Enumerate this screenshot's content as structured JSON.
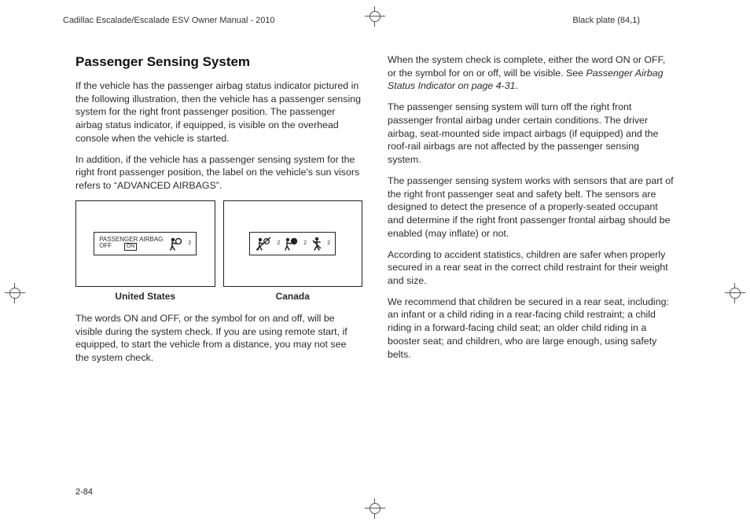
{
  "header": {
    "manual_title": "Cadillac Escalade/Escalade ESV Owner Manual - 2010",
    "plate": "Black plate (84,1)"
  },
  "left": {
    "heading": "Passenger Sensing System",
    "p1": "If the vehicle has the passenger airbag status indicator pictured in the following illustration, then the vehicle has a passenger sensing system for the right front passenger position. The passenger airbag status indicator, if equipped, is visible on the overhead console when the vehicle is started.",
    "p2": "In addition, if the vehicle has a passenger sensing system for the right front passenger position, the label on the vehicle's sun visors refers to “ADVANCED AIRBAGS”.",
    "illus_us_line1": "PASSENGER AIRBAG",
    "illus_us_off": "OFF",
    "illus_us_on": "ON",
    "caption_us": "United States",
    "caption_ca": "Canada",
    "p3": "The words ON and OFF, or the symbol for on and off, will be visible during the system check. If you are using remote start, if equipped, to start the vehicle from a distance, you may not see the system check."
  },
  "right": {
    "p1a": "When the system check is complete, either the word ON or OFF, or the symbol for on or off, will be visible. See ",
    "p1ref": "Passenger Airbag Status Indicator on page 4-31",
    "p1b": ".",
    "p2": "The passenger sensing system will turn off the right front passenger frontal airbag under certain conditions. The driver airbag, seat-mounted side impact airbags (if equipped) and the roof-rail airbags are not affected by the passenger sensing system.",
    "p3": "The passenger sensing system works with sensors that are part of the right front passenger seat and safety belt. The sensors are designed to detect the presence of a properly-seated occupant and determine if the right front passenger frontal airbag should be enabled (may inflate) or not.",
    "p4": "According to accident statistics, children are safer when properly secured in a rear seat in the correct child restraint for their weight and size.",
    "p5": "We recommend that children be secured in a rear seat, including: an infant or a child riding in a rear-facing child restraint; a child riding in a forward-facing child seat; an older child riding in a booster seat; and children, who are large enough, using safety belts."
  },
  "footer": {
    "page_number": "2-84"
  }
}
